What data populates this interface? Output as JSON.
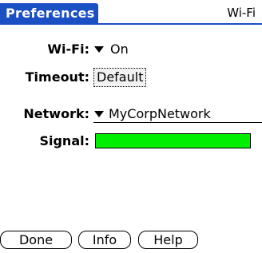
{
  "header": {
    "title": "Preferences",
    "panel": "Wi-Fi"
  },
  "form": {
    "wifi": {
      "label": "Wi-Fi:",
      "value": "On"
    },
    "timeout": {
      "label": "Timeout:",
      "value": "Default"
    },
    "network": {
      "label": "Network:",
      "value": "MyCorpNetwork"
    },
    "signal": {
      "label": "Signal:",
      "level": 1.0,
      "fill_color": "#00ee00"
    }
  },
  "buttons": {
    "done": "Done",
    "info": "Info",
    "help": "Help"
  },
  "colors": {
    "title_bar": "#1b4fc4",
    "signal": "#00ee00"
  }
}
